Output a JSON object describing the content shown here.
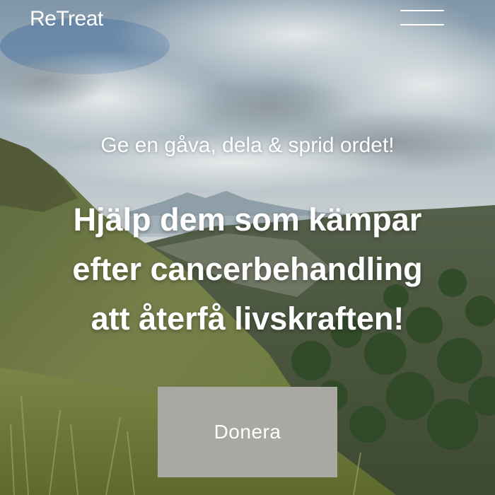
{
  "header": {
    "logo_text": "ReTreat",
    "menu_icon": "hamburger-menu-icon"
  },
  "hero": {
    "tagline": "Ge en gåva, dela & sprid ordet!",
    "headline_lines": [
      "Hjälp dem som kämpar",
      "efter cancerbehandling",
      "att återfå livskraften!"
    ],
    "cta_label": "Donera"
  },
  "colors": {
    "button_bg": "#a9a8a3",
    "text": "#ffffff"
  }
}
